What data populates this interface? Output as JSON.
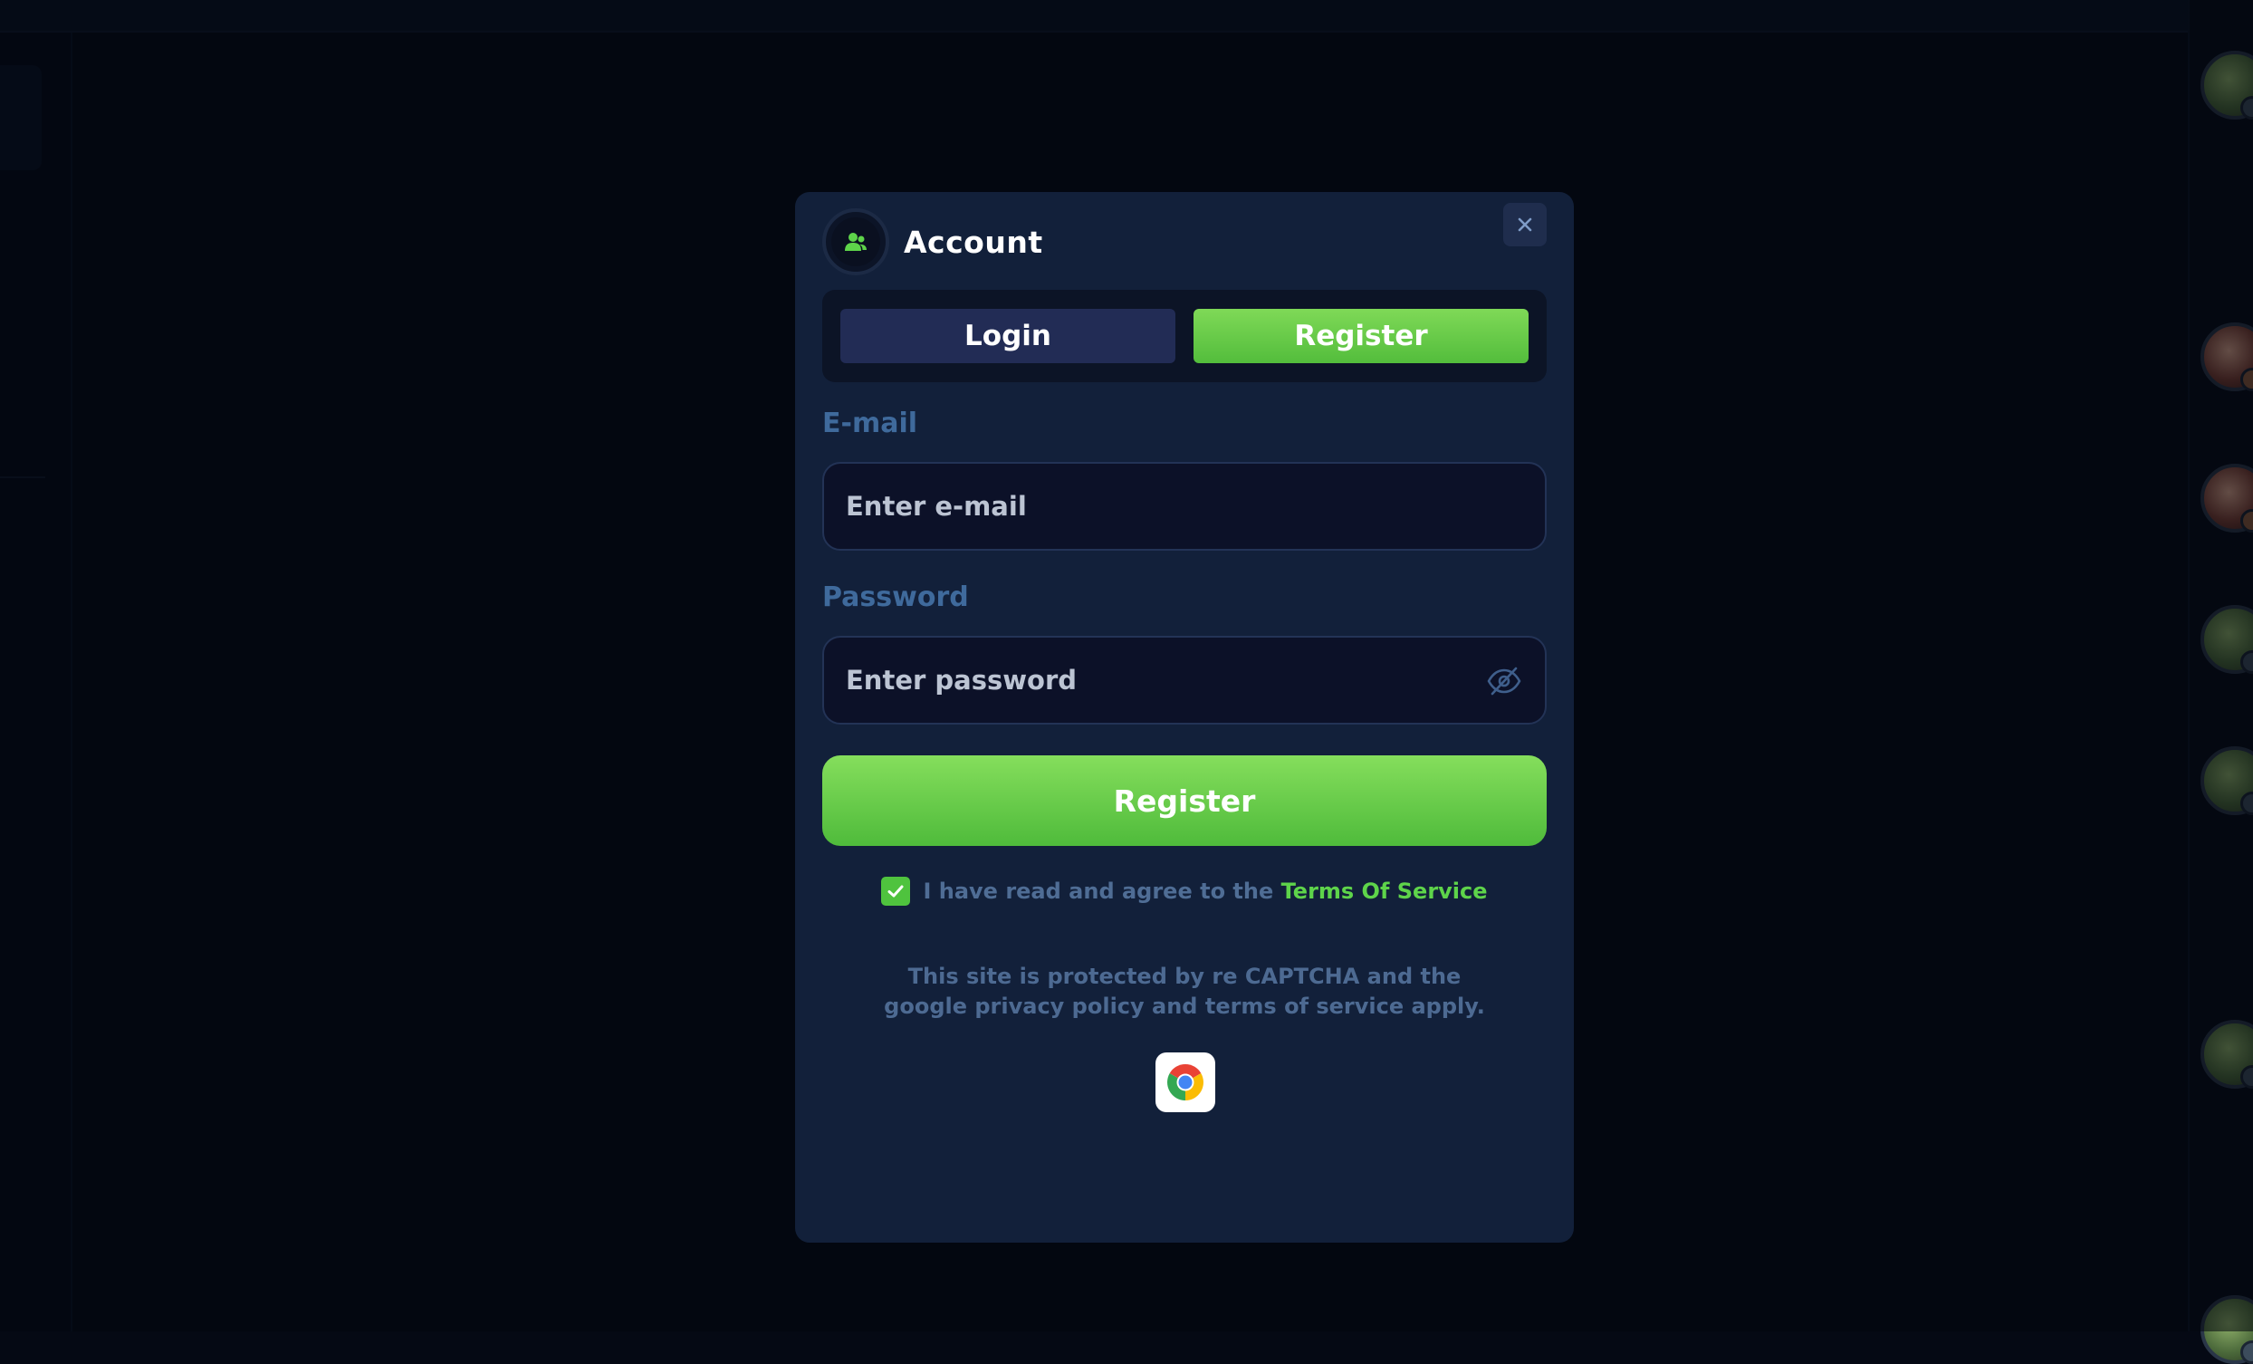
{
  "modal": {
    "title": "Account",
    "header_icon": "users-icon",
    "close_icon": "close-icon",
    "tabs": [
      {
        "label": "Login",
        "active": false
      },
      {
        "label": "Register",
        "active": true
      }
    ],
    "email": {
      "label": "E-mail",
      "placeholder": "Enter e-mail",
      "value": ""
    },
    "password": {
      "label": "Password",
      "placeholder": "Enter password",
      "value": "",
      "toggle_icon": "eye-off-icon"
    },
    "submit_label": "Register",
    "terms": {
      "checked": true,
      "text": "I have read and agree to the ",
      "link": "Terms Of Service"
    },
    "captcha_line1": "This site is protected by re CAPTCHA and the",
    "captcha_line2": "google privacy policy and terms of service apply.",
    "browser_icon": "chrome-icon"
  },
  "colors": {
    "accent_green": "#5ed44a",
    "modal_bg": "#12203a",
    "label_blue": "#3f6a9c",
    "page_bg": "#050914"
  }
}
